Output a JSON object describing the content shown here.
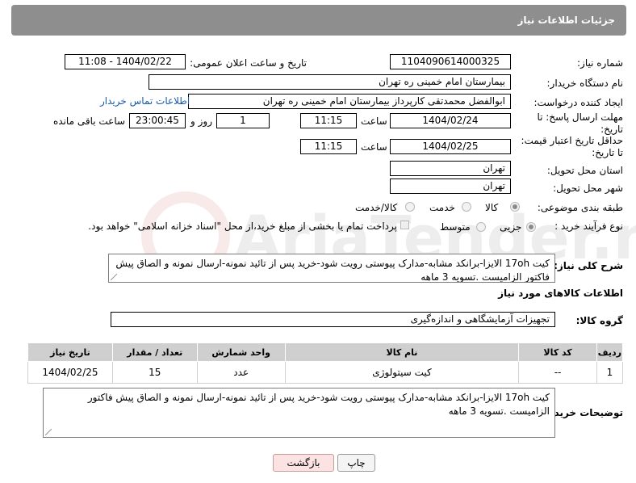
{
  "header": {
    "title": "جزئیات اطلاعات نیاز"
  },
  "form": {
    "need_number_label": "شماره نیاز:",
    "need_number": "1104090614000325",
    "announce_label": "تاریخ و ساعت اعلان عمومی:",
    "announce_value": "1404/02/22 - 11:08",
    "buyer_org_label": "نام دستگاه خریدار:",
    "buyer_org": "بیمارستان امام خمینی ره  تهران",
    "creator_label": "ایجاد کننده درخواست:",
    "creator": "ابوالفضل محمدتقی کارپرداز بیمارستان امام خمینی ره  تهران",
    "contact_link": "اطلاعات تماس خریدار",
    "deadline_label": "مهلت ارسال پاسخ: تا تاریخ:",
    "deadline_date": "1404/02/24",
    "time_label": "ساعت",
    "deadline_time": "11:15",
    "days_value": "1",
    "days_label": "روز و",
    "remaining_time": "23:00:45",
    "remaining_label": "ساعت باقی مانده",
    "validity_label": "حداقل تاریخ اعتبار قیمت: تا تاریخ:",
    "validity_date": "1404/02/25",
    "validity_time": "11:15",
    "province_label": "استان محل تحویل:",
    "province": "تهران",
    "city_label": "شهر محل تحویل:",
    "city": "تهران",
    "category_label": "طبقه بندی موضوعی:",
    "category_options": [
      "کالا",
      "خدمت",
      "کالا/خدمت"
    ],
    "process_label": "نوع فرآیند خرید :",
    "process_options": [
      "جزیی",
      "متوسط"
    ],
    "payment_note": "پرداخت تمام یا بخشی از مبلغ خرید،از محل \"اسناد خزانه اسلامی\" خواهد بود."
  },
  "description": {
    "label": "شرح کلی نیاز:",
    "text": "کیت 17oh الایزا-برانکد مشابه-مدارک پیوستی رویت شود-خرید پس از تائید نمونه-ارسال نمونه و الصاق پیش فاکتور الزامیست .تسویه 3 ماهه"
  },
  "goods": {
    "section_title": "اطلاعات کالاهای مورد نیاز",
    "group_label": "گروه کالا:",
    "group_value": "تجهیزات آزمایشگاهی و اندازه‌گیری",
    "columns": [
      "ردیف",
      "کد کالا",
      "نام کالا",
      "واحد شمارش",
      "تعداد / مقدار",
      "تاریخ نیاز"
    ],
    "rows": [
      {
        "row": "1",
        "code": "--",
        "name": "کیت سیتولوژی",
        "unit": "عدد",
        "qty": "15",
        "date": "1404/02/25"
      }
    ]
  },
  "buyer_notes": {
    "label": "توضیحات خریدار:",
    "text": "کیت 17oh الایزا-برانکد مشابه-مدارک پیوستی رویت شود-خرید پس از تائید نمونه-ارسال نمونه و الصاق پیش فاکتور الزامیست .تسویه 3 ماهه"
  },
  "buttons": {
    "print": "چاپ",
    "back": "بازگشت"
  },
  "watermark": {
    "text": "AriaTender.net"
  },
  "colors": {
    "header_bg": "#8e8e8e",
    "link": "#1a5aa8",
    "back_button_bg": "#fbe3e3"
  }
}
